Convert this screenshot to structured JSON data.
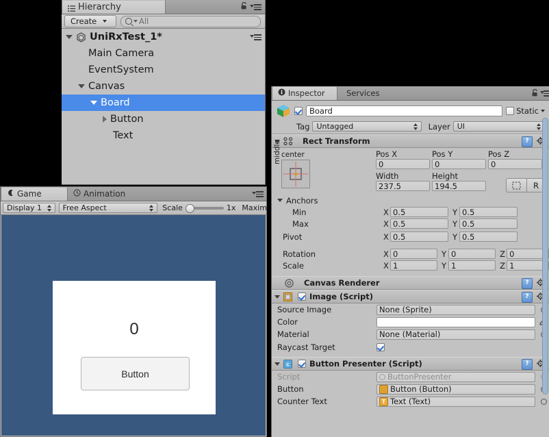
{
  "hierarchy": {
    "tab_label": "Hierarchy",
    "create_label": "Create",
    "search_placeholder": "All",
    "items": [
      {
        "label": "UniRxTest_1*",
        "depth": 0,
        "arrow": "down",
        "kind": "scene",
        "selected": false
      },
      {
        "label": "Main Camera",
        "depth": 1,
        "arrow": "none",
        "kind": "object",
        "selected": false
      },
      {
        "label": "EventSystem",
        "depth": 1,
        "arrow": "none",
        "kind": "object",
        "selected": false
      },
      {
        "label": "Canvas",
        "depth": 1,
        "arrow": "down",
        "kind": "object",
        "selected": false
      },
      {
        "label": "Board",
        "depth": 2,
        "arrow": "down",
        "kind": "object",
        "selected": true
      },
      {
        "label": "Button",
        "depth": 3,
        "arrow": "right",
        "kind": "object",
        "selected": false
      },
      {
        "label": "Text",
        "depth": 3,
        "arrow": "none",
        "kind": "object",
        "selected": false
      }
    ]
  },
  "game": {
    "tabs": [
      {
        "label": "Game",
        "active": true,
        "icon": "gamepad-icon"
      },
      {
        "label": "Animation",
        "active": false,
        "icon": "clock-icon"
      }
    ],
    "display_label": "Display 1",
    "aspect_label": "Free Aspect",
    "scale_label": "Scale",
    "scale_value": "1x",
    "maximize_label": "Maximize on Play",
    "maximize_visible_text": "Maximi",
    "background_color": "#395880",
    "board_color": "#ffffff",
    "counter_text": "0",
    "button_text": "Button"
  },
  "inspector": {
    "tabs": [
      {
        "label": "Inspector",
        "active": true,
        "icon": "info-icon"
      },
      {
        "label": "Services",
        "active": false,
        "icon": ""
      }
    ],
    "object_name": "Board",
    "object_enabled": true,
    "static_label": "Static",
    "static_checked": false,
    "tag_label": "Tag",
    "tag_value": "Untagged",
    "layer_label": "Layer",
    "layer_value": "UI",
    "components": [
      {
        "title": "Rect Transform",
        "icon": "rect-transform-icon",
        "enabled": null,
        "anchor_preset": {
          "horizontal": "center",
          "vertical": "middle"
        },
        "fields": {
          "pos_x_label": "Pos X",
          "pos_x": "0",
          "pos_y_label": "Pos Y",
          "pos_y": "0",
          "pos_z_label": "Pos Z",
          "pos_z": "0",
          "width_label": "Width",
          "width": "237.5",
          "height_label": "Height",
          "height": "194.5",
          "blueprint_label": "",
          "raw_label": "R",
          "anchors_label": "Anchors",
          "min_label": "Min",
          "min_x": "0.5",
          "min_y": "0.5",
          "max_label": "Max",
          "max_x": "0.5",
          "max_y": "0.5",
          "pivot_label": "Pivot",
          "pivot_x": "0.5",
          "pivot_y": "0.5",
          "rotation_label": "Rotation",
          "rot_x": "0",
          "rot_y": "0",
          "rot_z": "0",
          "scale_label": "Scale",
          "scale_x": "1",
          "scale_y": "1",
          "scale_z": "1"
        }
      },
      {
        "title": "Canvas Renderer",
        "icon": "canvas-renderer-icon",
        "enabled": null,
        "rows": []
      },
      {
        "title": "Image (Script)",
        "icon": "image-script-icon",
        "enabled": true,
        "rows": [
          {
            "label": "Source Image",
            "value": "None (Sprite)",
            "type": "object",
            "suffix": "circle-select-icon"
          },
          {
            "label": "Color",
            "value": "",
            "type": "color",
            "suffix": "eyedropper-icon"
          },
          {
            "label": "Material",
            "value": "None (Material)",
            "type": "object",
            "suffix": "circle-select-icon"
          },
          {
            "label": "Raycast Target",
            "value": "",
            "type": "checkbox",
            "checked": true,
            "suffix": ""
          }
        ]
      },
      {
        "title": "Button Presenter (Script)",
        "icon": "cs-script-icon",
        "enabled": true,
        "rows": [
          {
            "label": "Script",
            "value": "ButtonPresenter",
            "type": "script",
            "dim": true,
            "suffix": "circle-select-icon"
          },
          {
            "label": "Button",
            "value": "Button (Button)",
            "type": "object",
            "badge": "button-icon",
            "suffix": "circle-select-icon"
          },
          {
            "label": "Counter Text",
            "value": "Text (Text)",
            "type": "object",
            "badge": "text-icon",
            "suffix": "circle-select-icon"
          }
        ]
      }
    ]
  }
}
